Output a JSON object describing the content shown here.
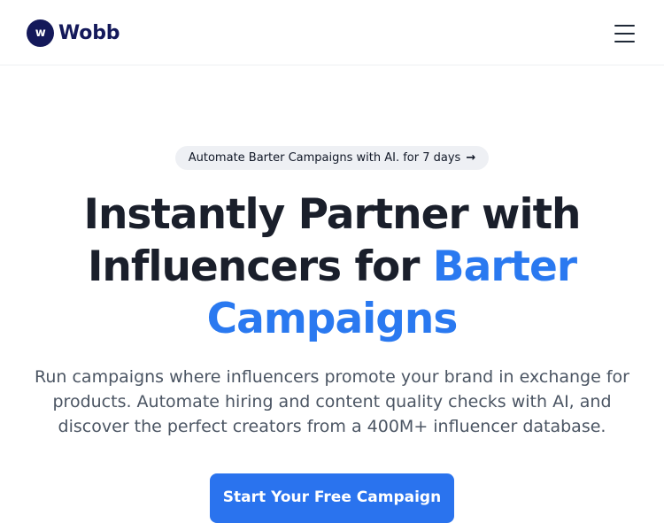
{
  "brand": {
    "logo_letter": "w",
    "name": "Wobb"
  },
  "header": {
    "menu_icon": "hamburger-menu-icon"
  },
  "announcement": {
    "text": "Automate Barter Campaigns with AI. for 7 days",
    "arrow": "→"
  },
  "hero": {
    "title_line1": "Instantly Partner with",
    "title_line2_plain": "Influencers for",
    "title_line2_accent": "Barter",
    "title_line3_accent": "Campaigns",
    "subtitle": "Run campaigns where influencers promote your brand in exchange for products. Automate hiring and content quality checks with AI, and discover the perfect creators from a 400M+ influencer database.",
    "cta_label": "Start Your Free Campaign"
  },
  "colors": {
    "brand_navy": "#14195a",
    "accent_blue": "#2a79f0",
    "cta_blue": "#2a73ee",
    "badge_bg": "#eef0f4"
  }
}
